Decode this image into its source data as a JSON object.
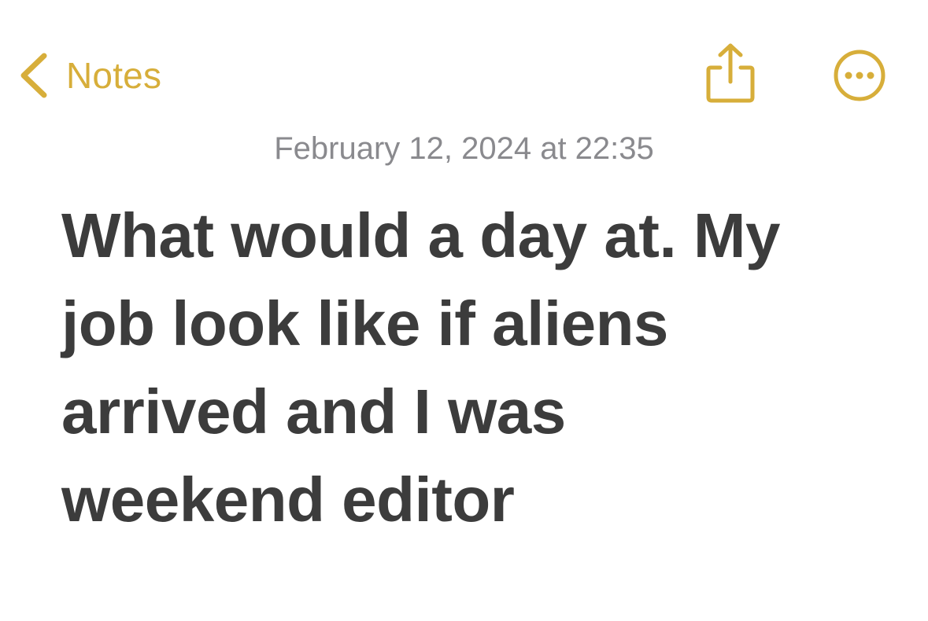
{
  "nav": {
    "back_label": "Notes",
    "back_icon": "chevron-left-icon",
    "share_icon": "share-icon",
    "more_icon": "ellipsis-circle-icon",
    "accent_color": "#D7AE3A"
  },
  "note": {
    "timestamp": "February 12, 2024 at 22:35",
    "lines": [
      "What would a day at. My",
      "job look like if aliens",
      "arrived and I was",
      "weekend editor"
    ],
    "text_color": "#3C3C3C",
    "timestamp_color": "#8A8A8E"
  }
}
